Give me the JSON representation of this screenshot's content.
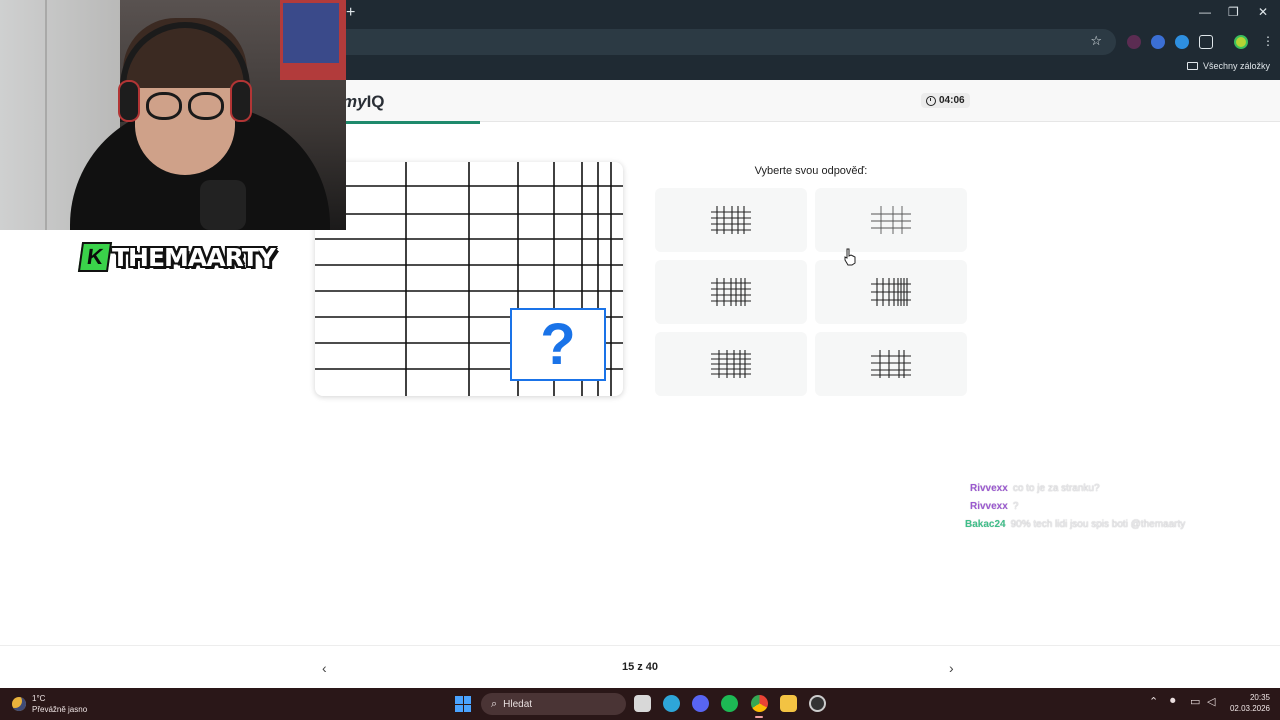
{
  "browser": {
    "new_tab_glyph": "+",
    "window_controls": [
      "—",
      "❐",
      "✕"
    ],
    "all_bookmarks": "Všechny záložky"
  },
  "site": {
    "logo_italic": "my",
    "logo_bold": "IQ",
    "timer": "04:06",
    "progress_fraction": 0.375
  },
  "question": {
    "placeholder": "?",
    "prompt": "Vyberte svou odpověď:",
    "options": [
      {
        "id": "a",
        "label": "option-1"
      },
      {
        "id": "b",
        "label": "option-2"
      },
      {
        "id": "c",
        "label": "option-3"
      },
      {
        "id": "d",
        "label": "option-4"
      },
      {
        "id": "e",
        "label": "option-5"
      },
      {
        "id": "f",
        "label": "option-6"
      }
    ]
  },
  "pagination": {
    "prev_glyph": "‹",
    "next_glyph": "›",
    "counter": "15 z 40"
  },
  "stream": {
    "brand_mark": "K",
    "brand": "THEMAARTY"
  },
  "chat": [
    {
      "user": "Rivvexx",
      "user_color": "#9b59d0",
      "message": "co to je za stranku?"
    },
    {
      "user": "Rivvexx",
      "user_color": "#9b59d0",
      "message": "?"
    },
    {
      "user": "Bakac24",
      "user_color": "#3fbf8a",
      "message": "90% tech lidi jsou spis boti @themaarty"
    }
  ],
  "taskbar": {
    "temperature": "1°C",
    "weather": "Převážně jasno",
    "search_placeholder": "Hledat",
    "time": "20:35",
    "date": "02.03.2026"
  },
  "colors": {
    "accent": "#1a73e8",
    "progress": "#1e8a6c",
    "chrome_bg": "#1f2a33",
    "taskbar_bg": "#2a1718"
  }
}
